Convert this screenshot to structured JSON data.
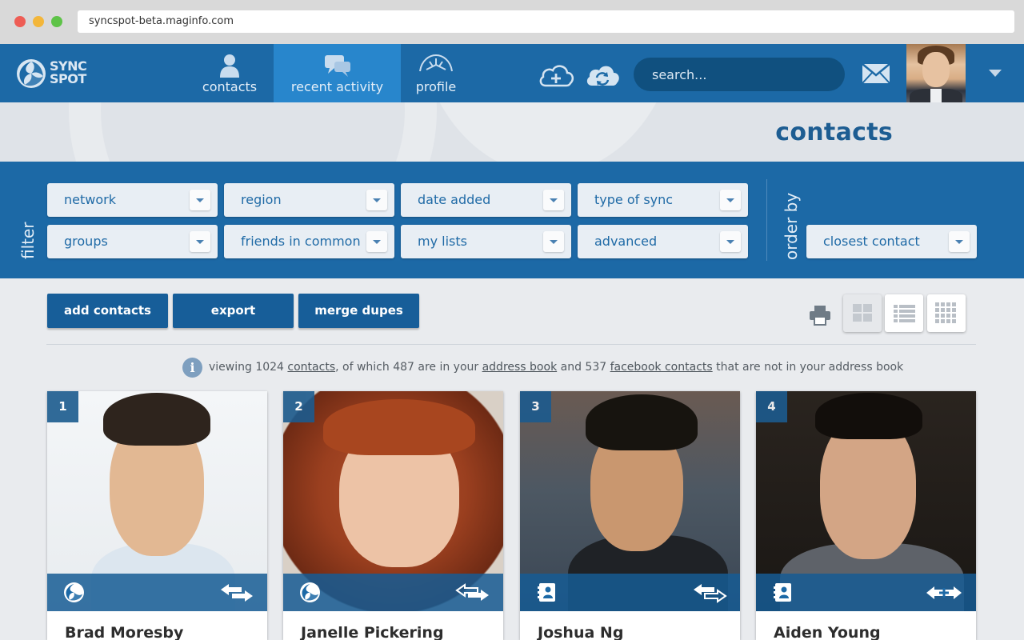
{
  "browser": {
    "url": "syncspot-beta.maginfo.com"
  },
  "brand": {
    "line1": "SYNC",
    "line2": "SPOT"
  },
  "nav": {
    "contacts": "contacts",
    "recent_activity": "recent activity",
    "profile": "profile"
  },
  "search": {
    "placeholder": "search..."
  },
  "page": {
    "title": "contacts"
  },
  "filter": {
    "label": "filter",
    "dropdowns": [
      "network",
      "region",
      "date added",
      "type of sync",
      "groups",
      "friends in common",
      "my lists",
      "advanced"
    ]
  },
  "order_by": {
    "label": "order by",
    "value": "closest contact"
  },
  "actions": {
    "add": "add contacts",
    "export": "export",
    "merge": "merge dupes"
  },
  "info": {
    "icon": "i",
    "prefix": "viewing 1024 ",
    "contacts_link": "contacts",
    "mid1": ", of which 487 are in your ",
    "address_book_link": "address book",
    "mid2": " and 537 ",
    "facebook_link": "facebook contacts",
    "suffix": " that are not in your address book"
  },
  "cards": [
    {
      "index": "1",
      "name": "Brad Moresby",
      "source_icon": "syncspot-icon",
      "sync_icon": "two-way-sync-icon"
    },
    {
      "index": "2",
      "name": "Janelle Pickering",
      "source_icon": "syncspot-icon",
      "sync_icon": "two-way-sync-icon"
    },
    {
      "index": "3",
      "name": "Joshua Ng",
      "source_icon": "address-book-icon",
      "sync_icon": "two-way-sync-icon"
    },
    {
      "index": "4",
      "name": "Aiden Young",
      "source_icon": "address-book-icon",
      "sync_icon": "add-sync-icon"
    }
  ],
  "colors": {
    "primary": "#1c69a6",
    "active_tab": "#2886cc",
    "button": "#175e99",
    "title": "#1d5d92"
  }
}
